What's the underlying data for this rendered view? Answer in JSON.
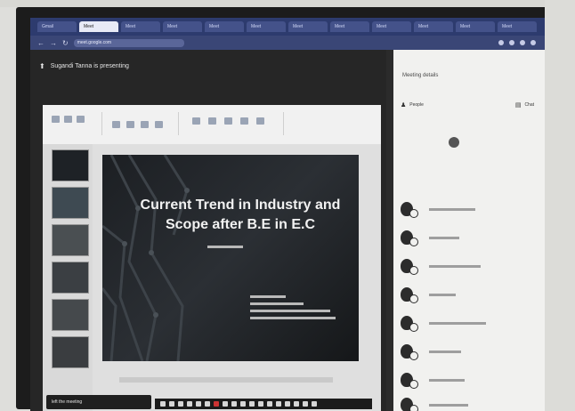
{
  "browser": {
    "tabs": [
      "Gmail",
      "Meet",
      "Meet",
      "Meet",
      "Meet",
      "Meet",
      "Meet",
      "Meet",
      "Meet",
      "Meet",
      "Meet",
      "Meet"
    ],
    "url": "meet.google.com"
  },
  "meeting": {
    "presenting_text": "Sugandi Tanna is presenting"
  },
  "slide": {
    "title_line1": "Current Trend in Industry and",
    "title_line2": "Scope after B.E in E.C"
  },
  "notification": {
    "text": "left the meeting"
  },
  "participants": {
    "title": "Meeting details",
    "tab_people": "People",
    "tab_chat": "Chat"
  },
  "colors": {
    "tab_strip": "#2d3b6e",
    "slide_bg": "#1c1f23",
    "panel_bg": "#f1f1ef"
  }
}
